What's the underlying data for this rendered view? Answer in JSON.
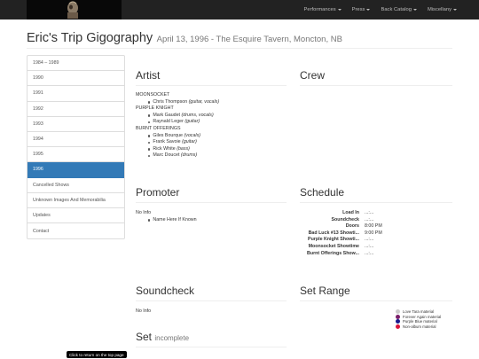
{
  "nav": {
    "items": [
      "Performances",
      "Press",
      "Back Catalog",
      "Miscellany"
    ]
  },
  "title": {
    "main": "Eric's Trip Gigography",
    "sub": "April 13, 1996 - The Esquire Tavern, Moncton, NB"
  },
  "sidebar": {
    "items": [
      "1984 – 1989",
      "1990",
      "1991",
      "1992",
      "1993",
      "1994",
      "1995",
      "1996",
      "Cancelled Shows",
      "Unknown Images And Memorabilia",
      "Updates",
      "Contact"
    ],
    "active_index": 7
  },
  "artist": {
    "heading": "Artist",
    "bands": [
      {
        "name": "MOONSOCKET",
        "members": [
          {
            "name": "Chris Thompson",
            "role": "(guitar, vocals)"
          }
        ]
      },
      {
        "name": "PURPLE KNIGHT",
        "members": [
          {
            "name": "Mark Gaudet",
            "role": "(drums, vocals)"
          },
          {
            "name": "Raynald Leger",
            "role": "(guitar)"
          }
        ]
      },
      {
        "name": "BURNT OFFERINGS",
        "members": [
          {
            "name": "Giles Bourque",
            "role": "(vocals)"
          },
          {
            "name": "Frank Savoie",
            "role": "(guitar)"
          },
          {
            "name": "Rick White",
            "role": "(bass)"
          },
          {
            "name": "Marc Doucet",
            "role": "(drums)"
          }
        ]
      }
    ]
  },
  "crew": {
    "heading": "Crew"
  },
  "promoter": {
    "heading": "Promoter",
    "line": "No Info",
    "item": "Name Here If Known"
  },
  "schedule": {
    "heading": "Schedule",
    "rows": [
      {
        "label": "Load In",
        "value": "...:..."
      },
      {
        "label": "Soundcheck",
        "value": "...:..."
      },
      {
        "label": "Doors",
        "value": "8:00 PM"
      },
      {
        "label": "Bad Luck #13 Showti...",
        "value": "9:00 PM"
      },
      {
        "label": "Purple Knight Showti...",
        "value": "...:..."
      },
      {
        "label": "Moonsocket Showtime",
        "value": "...:..."
      },
      {
        "label": "Burnt Offerings Show...",
        "value": "...:..."
      }
    ]
  },
  "soundcheck": {
    "heading": "Soundcheck",
    "line": "No Info"
  },
  "set_range": {
    "heading": "Set Range",
    "legend": [
      {
        "label": "Love Tara material",
        "color": "#cccccc"
      },
      {
        "label": "Forever Again material",
        "color": "#7b1f6a"
      },
      {
        "label": "Purple Blue material",
        "color": "#1a1a8c"
      },
      {
        "label": "Non-album material",
        "color": "#d9143a"
      }
    ]
  },
  "set": {
    "heading": "Set",
    "note": "incomplete"
  },
  "tooltip": "Click to return on the top page"
}
